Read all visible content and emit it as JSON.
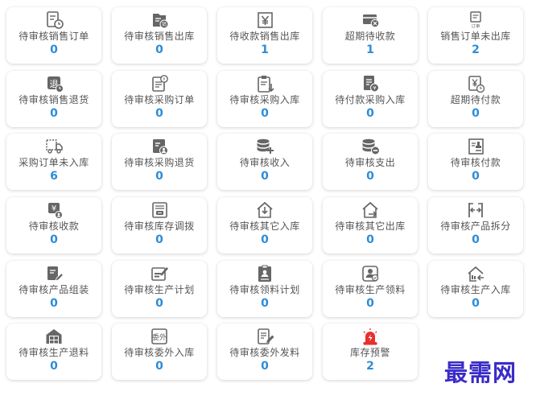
{
  "cards": [
    {
      "label": "待审核销售订单",
      "count": "0",
      "icon": "order-clock-icon"
    },
    {
      "label": "待审核销售出库",
      "count": "0",
      "icon": "folder-sales-icon"
    },
    {
      "label": "待收款销售出库",
      "count": "1",
      "icon": "yen-receipt-icon"
    },
    {
      "label": "超期待收款",
      "count": "1",
      "icon": "card-overdue-icon"
    },
    {
      "label": "销售订单未出库",
      "count": "2",
      "icon": "order-doc-icon"
    },
    {
      "label": "待审核销售退货",
      "count": "0",
      "icon": "return-icon"
    },
    {
      "label": "待审核采购订单",
      "count": "0",
      "icon": "purchase-order-icon"
    },
    {
      "label": "待审核采购入库",
      "count": "0",
      "icon": "clipboard-inbound-icon"
    },
    {
      "label": "待付款采购入库",
      "count": "0",
      "icon": "doc-yen-icon"
    },
    {
      "label": "超期待付款",
      "count": "0",
      "icon": "yen-clock-icon"
    },
    {
      "label": "采购订单未入库",
      "count": "6",
      "icon": "truck-icon"
    },
    {
      "label": "待审核采购退货",
      "count": "0",
      "icon": "doc-person-icon"
    },
    {
      "label": "待审核收入",
      "count": "0",
      "icon": "coins-plus-icon"
    },
    {
      "label": "待审核支出",
      "count": "0",
      "icon": "coins-minus-icon"
    },
    {
      "label": "待审核付款",
      "count": "0",
      "icon": "stamp-doc-icon"
    },
    {
      "label": "待审核收款",
      "count": "0",
      "icon": "yen-hand-icon"
    },
    {
      "label": "待审核库存调拨",
      "count": "0",
      "icon": "transfer-doc-icon"
    },
    {
      "label": "待审核其它入库",
      "count": "0",
      "icon": "house-in-icon"
    },
    {
      "label": "待审核其它出库",
      "count": "0",
      "icon": "house-out-icon"
    },
    {
      "label": "待审核产品拆分",
      "count": "0",
      "icon": "split-icon"
    },
    {
      "label": "待审核产品组装",
      "count": "0",
      "icon": "doc-pen-icon"
    },
    {
      "label": "待审核生产计划",
      "count": "0",
      "icon": "plan-pen-icon"
    },
    {
      "label": "待审核领料计划",
      "count": "0",
      "icon": "clipboard-person-icon"
    },
    {
      "label": "待审核生产领料",
      "count": "0",
      "icon": "person-badge-icon"
    },
    {
      "label": "待审核生产入库",
      "count": "0",
      "icon": "factory-in-icon"
    },
    {
      "label": "待审核生产退料",
      "count": "0",
      "icon": "warehouse-icon"
    },
    {
      "label": "待审核委外入库",
      "count": "0",
      "icon": "outsource-icon"
    },
    {
      "label": "待审核委外发料",
      "count": "0",
      "icon": "doc-edit-icon"
    },
    {
      "label": "库存预警",
      "count": "2",
      "icon": "alarm-icon"
    }
  ],
  "watermark": "最需网",
  "colors": {
    "count": "#2d8cd6",
    "label": "#555555",
    "icon": "#666666",
    "alarm": "#e5322d",
    "watermark": "#3b2cc8"
  }
}
